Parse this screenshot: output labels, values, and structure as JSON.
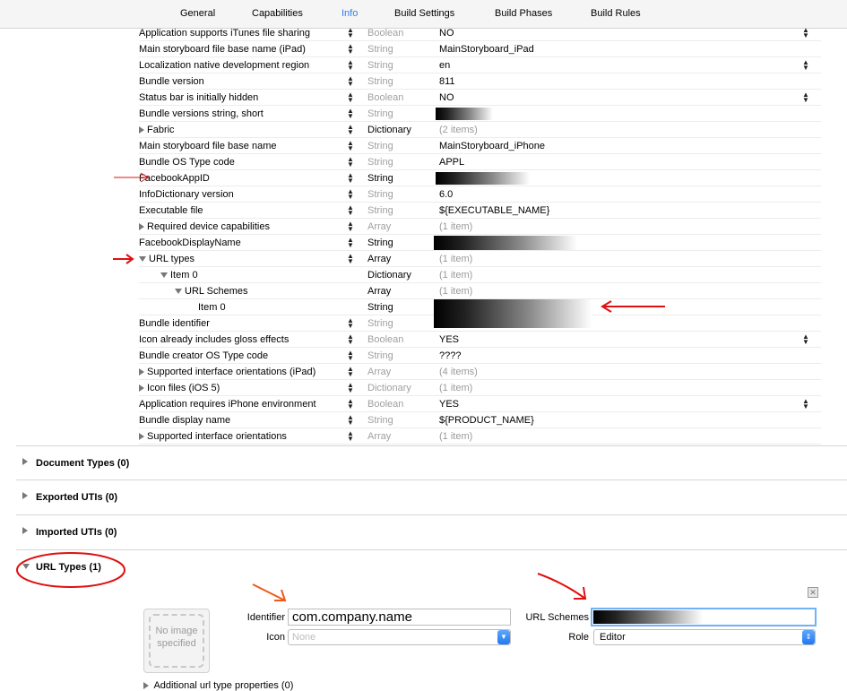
{
  "tabs": [
    {
      "label": "General"
    },
    {
      "label": "Capabilities"
    },
    {
      "label": "Info"
    },
    {
      "label": "Build Settings"
    },
    {
      "label": "Build Phases"
    },
    {
      "label": "Build Rules"
    }
  ],
  "plist_rows": [
    {
      "key": "Application supports iTunes file sharing",
      "type": "Boolean",
      "value": "NO"
    },
    {
      "key": "Main storyboard file base name (iPad)",
      "type": "String",
      "value": "MainStoryboard_iPad"
    },
    {
      "key": "Localization native development region",
      "type": "String",
      "value": "en"
    },
    {
      "key": "Bundle version",
      "type": "String",
      "value": "811"
    },
    {
      "key": "Status bar is initially hidden",
      "type": "Boolean",
      "value": "NO"
    },
    {
      "key": "Bundle versions string, short",
      "type": "String",
      "value": ""
    },
    {
      "key": "Fabric",
      "type": "Dictionary",
      "value": "(2 items)"
    },
    {
      "key": "Main storyboard file base name",
      "type": "String",
      "value": "MainStoryboard_iPhone"
    },
    {
      "key": "Bundle OS Type code",
      "type": "String",
      "value": "APPL"
    },
    {
      "key": "FacebookAppID",
      "type": "String",
      "value": ""
    },
    {
      "key": "InfoDictionary version",
      "type": "String",
      "value": "6.0"
    },
    {
      "key": "Executable file",
      "type": "String",
      "value": "${EXECUTABLE_NAME}"
    },
    {
      "key": "Required device capabilities",
      "type": "Array",
      "value": "(1 item)"
    },
    {
      "key": "FacebookDisplayName",
      "type": "String",
      "value": ""
    },
    {
      "key": "URL types",
      "type": "Array",
      "value": "(1 item)"
    },
    {
      "key": "Item 0",
      "type": "Dictionary",
      "value": "(1 item)"
    },
    {
      "key": "URL Schemes",
      "type": "Array",
      "value": "(1 item)"
    },
    {
      "key": "Item 0",
      "type": "String",
      "value": ""
    },
    {
      "key": "Bundle identifier",
      "type": "String",
      "value": ""
    },
    {
      "key": "Icon already includes gloss effects",
      "type": "Boolean",
      "value": "YES"
    },
    {
      "key": "Bundle creator OS Type code",
      "type": "String",
      "value": "????"
    },
    {
      "key": "Supported interface orientations (iPad)",
      "type": "Array",
      "value": "(4 items)"
    },
    {
      "key": "Icon files (iOS 5)",
      "type": "Dictionary",
      "value": "(1 item)"
    },
    {
      "key": "Application requires iPhone environment",
      "type": "Boolean",
      "value": "YES"
    },
    {
      "key": "Bundle display name",
      "type": "String",
      "value": "${PRODUCT_NAME}"
    },
    {
      "key": "Supported interface orientations",
      "type": "Array",
      "value": "(1 item)"
    }
  ],
  "sections": [
    {
      "title": "Document Types (0)"
    },
    {
      "title": "Exported UTIs (0)"
    },
    {
      "title": "Imported UTIs (0)"
    },
    {
      "title": "URL Types (1)"
    }
  ],
  "url_type": {
    "no_image": "No image specified",
    "identifier_label": "Identifier",
    "identifier_value": "com.company.name",
    "icon_label": "Icon",
    "icon_placeholder": "None",
    "url_schemes_label": "URL Schemes",
    "role_label": "Role",
    "role_value": "Editor",
    "additional": "Additional url type properties (0)"
  },
  "colors": {
    "accent": "#2f7df6",
    "annotation": "#e01010"
  }
}
